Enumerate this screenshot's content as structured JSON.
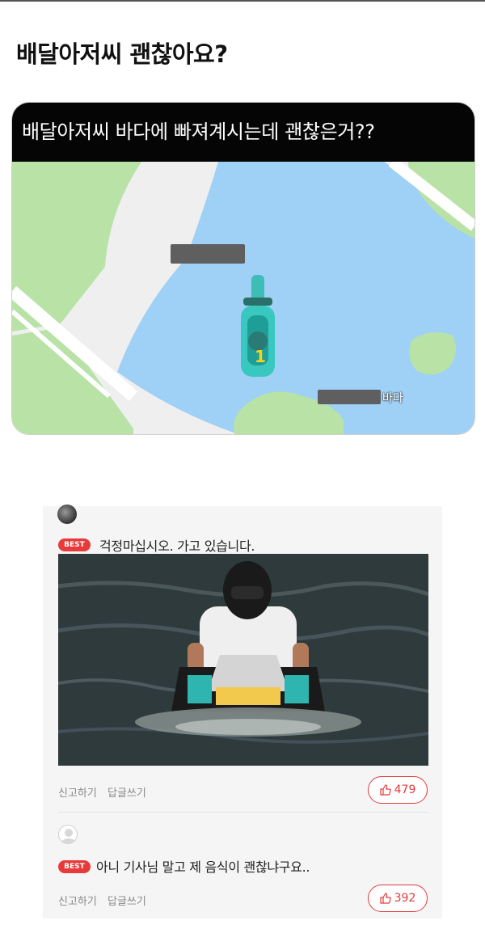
{
  "post": {
    "title": "배달아저씨 괜찮아요?"
  },
  "map_card": {
    "header": "배달아저씨 바다에 빠져계시는데 괜찮은거??",
    "sea_label": "바다",
    "rider_number": "1"
  },
  "comments": [
    {
      "badge": "BEST",
      "text": "걱정마십시오. 가고 있습니다.",
      "report_label": "신고하기",
      "reply_label": "답글쓰기",
      "likes": "479"
    },
    {
      "badge": "BEST",
      "text": "아니 기사님 말고 제 음식이 괜찮냐구요..",
      "report_label": "신고하기",
      "reply_label": "답글쓰기",
      "likes": "392"
    }
  ],
  "colors": {
    "accent": "#e23b3b",
    "water": "#9fd0f5",
    "land": "#b9e3a6"
  }
}
